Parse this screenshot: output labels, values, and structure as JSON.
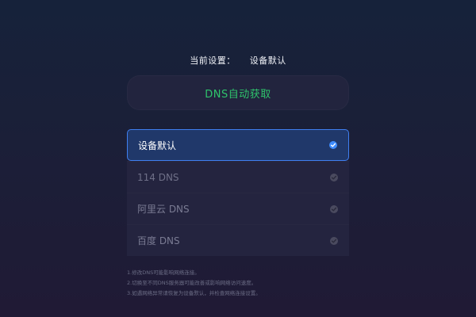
{
  "current_setting": {
    "label": "当前设置：",
    "value": "设备默认"
  },
  "status": {
    "text": "DNS自动获取",
    "color": "#2fc46c"
  },
  "dns_options": [
    {
      "label": "设备默认",
      "selected": true
    },
    {
      "label": "114 DNS",
      "selected": false
    },
    {
      "label": "阿里云 DNS",
      "selected": false
    },
    {
      "label": "百度 DNS",
      "selected": false
    }
  ],
  "notes": [
    "1.修改DNS可能影响网络连接。",
    "2.切换至不同DNS服务器可能改善或影响网络访问速度。",
    "3.如遇网络异常请恢复为设备默认，并检查网络连接设置。"
  ],
  "icons": {
    "check": "check-icon"
  },
  "colors": {
    "accent": "#3f7ff1",
    "selected_bg": "#20386a",
    "list_bg": "#24243f"
  }
}
